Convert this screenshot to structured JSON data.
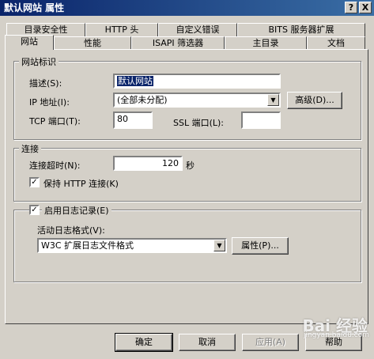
{
  "window": {
    "title": "默认网站 属性",
    "help_btn": "?",
    "close_btn": "X"
  },
  "tabs_back": [
    "目录安全性",
    "HTTP 头",
    "自定义错误",
    "BITS 服务器扩展"
  ],
  "tabs_front": [
    "网站",
    "性能",
    "ISAPI 筛选器",
    "主目录",
    "文档"
  ],
  "identity": {
    "group_label": "网站标识",
    "desc_label": "描述(S):",
    "desc_value": "默认网站",
    "ip_label": "IP 地址(I):",
    "ip_value": "(全部未分配)",
    "advanced_btn": "高级(D)...",
    "tcp_label": "TCP 端口(T):",
    "tcp_value": "80",
    "ssl_label": "SSL 端口(L):",
    "ssl_value": ""
  },
  "connection": {
    "group_label": "连接",
    "timeout_label": "连接超时(N):",
    "timeout_value": "120",
    "timeout_unit": "秒",
    "keepalive_label": "保持 HTTP 连接(K)",
    "keepalive_checked": true
  },
  "logging": {
    "enable_label": "启用日志记录(E)",
    "enable_checked": true,
    "format_label": "活动日志格式(V):",
    "format_value": "W3C 扩展日志文件格式",
    "props_btn": "属性(P)..."
  },
  "footer": {
    "ok": "确定",
    "cancel": "取消",
    "apply": "应用(A)",
    "help": "帮助"
  },
  "watermark": {
    "text": "Bai 经验",
    "url": "jingyan.baidu.com"
  }
}
